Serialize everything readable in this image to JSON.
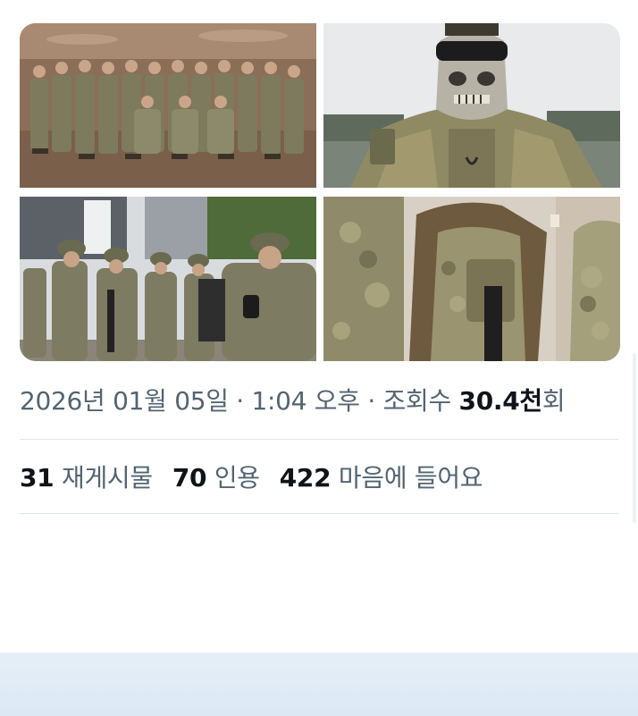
{
  "post": {
    "date": "2026년 01월 05일",
    "sep1": " · ",
    "time": "1:04 오후",
    "sep2": " · ",
    "views_label": "조회수 ",
    "views_count": "30.4천",
    "views_suffix": "회"
  },
  "stats": {
    "reposts_count": "31",
    "reposts_label": "재게시물",
    "quotes_count": "70",
    "quotes_label": "인용",
    "likes_count": "422",
    "likes_label": "마음에 들어요"
  },
  "colors": {
    "secondary_text": "#536471",
    "primary_text": "#0f1419",
    "divider": "#e1e6ea",
    "bottom_band": "#dde9f5"
  },
  "media": [
    {
      "name": "photo-group-soldiers"
    },
    {
      "name": "photo-skull-mask-soldier"
    },
    {
      "name": "photo-soldiers-outdoors"
    },
    {
      "name": "photo-soldiers-indoors"
    }
  ]
}
